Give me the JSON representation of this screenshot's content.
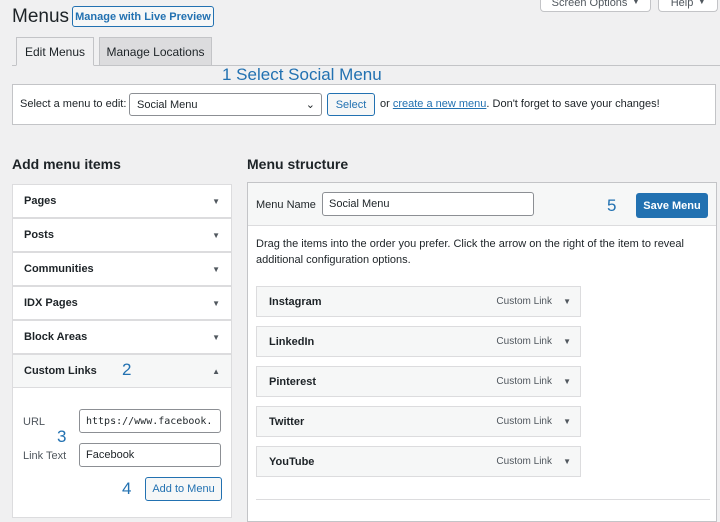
{
  "header": {
    "title": "Menus",
    "live_preview_label": "Manage with Live Preview",
    "screen_options_label": "Screen Options",
    "help_label": "Help"
  },
  "tabs": [
    {
      "label": "Edit Menus",
      "active": true
    },
    {
      "label": "Manage Locations",
      "active": false
    }
  ],
  "annotations": {
    "step1": "1 Select Social Menu",
    "step2": "2",
    "step3": "3",
    "step4": "4",
    "step5": "5"
  },
  "select_bar": {
    "label": "Select a menu to edit:",
    "selected_menu": "Social Menu",
    "select_button": "Select",
    "note_prefix": "or",
    "create_link": "create a new menu",
    "note_suffix": ". Don't forget to save your changes!"
  },
  "add_items": {
    "heading": "Add menu items",
    "sections": [
      {
        "label": "Pages",
        "expanded": false
      },
      {
        "label": "Posts",
        "expanded": false
      },
      {
        "label": "Communities",
        "expanded": false
      },
      {
        "label": "IDX Pages",
        "expanded": false
      },
      {
        "label": "Block Areas",
        "expanded": false
      },
      {
        "label": "Custom Links",
        "expanded": true
      }
    ],
    "custom_links": {
      "url_label": "URL",
      "url_value": "https://www.facebook.",
      "link_text_label": "Link Text",
      "link_text_value": "Facebook",
      "add_button": "Add to Menu"
    }
  },
  "structure": {
    "heading": "Menu structure",
    "menu_name_label": "Menu Name",
    "menu_name_value": "Social Menu",
    "save_button": "Save Menu",
    "instructions": "Drag the items into the order you prefer. Click the arrow on the right of the item to reveal additional configuration options.",
    "items": [
      {
        "title": "Instagram",
        "type": "Custom Link"
      },
      {
        "title": "LinkedIn",
        "type": "Custom Link"
      },
      {
        "title": "Pinterest",
        "type": "Custom Link"
      },
      {
        "title": "Twitter",
        "type": "Custom Link"
      },
      {
        "title": "YouTube",
        "type": "Custom Link"
      }
    ]
  },
  "colors": {
    "accent": "#2271b1",
    "background": "#f0f0f1",
    "border": "#c3c4c7"
  },
  "icons": {
    "dropdown": "chevron-down-icon",
    "collapsed": "triangle-down-icon",
    "expanded": "triangle-up-icon"
  }
}
